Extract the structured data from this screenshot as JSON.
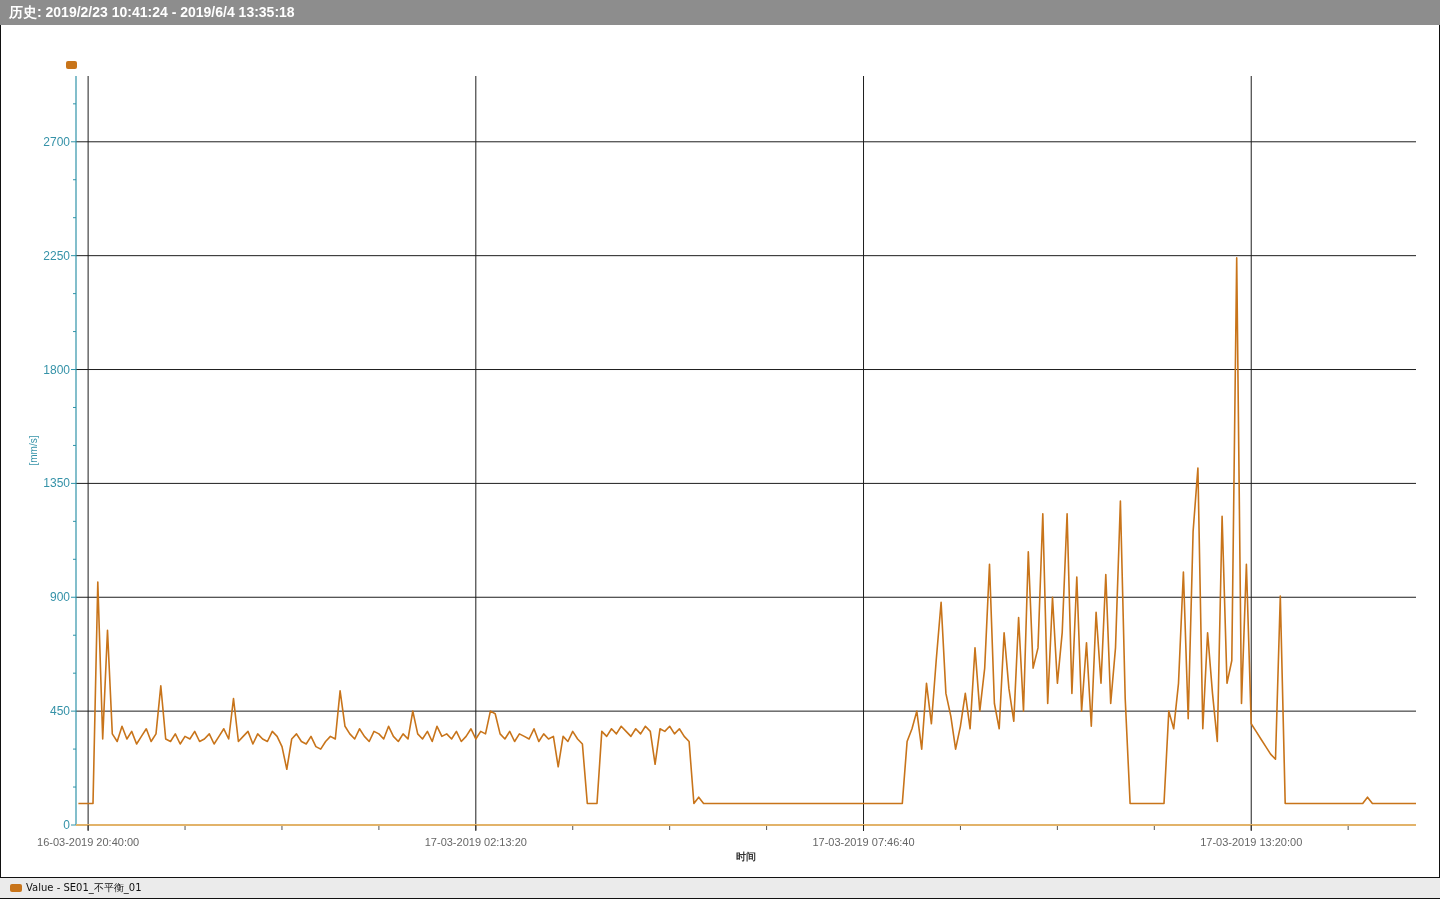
{
  "title_bar": {
    "title": "历史: 2019/2/23 10:41:24 - 2019/6/4 13:35:18"
  },
  "chart": {
    "chart_data": {
      "type": "line",
      "xlabel": "时间",
      "ylabel": "[mm/s]",
      "grid": true,
      "categories": [
        null,
        null,
        "16-03-2019 20:40:00",
        null,
        null,
        null,
        null,
        null,
        null,
        null,
        null,
        null,
        null,
        null,
        null,
        null,
        null,
        null,
        null,
        null,
        null,
        null,
        null,
        null,
        null,
        null,
        null,
        null,
        null,
        null,
        null,
        null,
        null,
        null,
        null,
        null,
        null,
        null,
        null,
        null,
        null,
        null,
        null,
        null,
        null,
        null,
        null,
        null,
        null,
        null,
        null,
        null,
        null,
        null,
        null,
        null,
        null,
        null,
        null,
        null,
        null,
        null,
        null,
        null,
        null,
        null,
        null,
        null,
        null,
        null,
        null,
        null,
        null,
        null,
        null,
        null,
        null,
        null,
        null,
        null,
        null,
        null,
        "17-03-2019 02:13:20",
        null,
        null,
        null,
        null,
        null,
        null,
        null,
        null,
        null,
        null,
        null,
        null,
        null,
        null,
        null,
        null,
        null,
        null,
        null,
        null,
        null,
        null,
        null,
        null,
        null,
        null,
        null,
        null,
        null,
        null,
        null,
        null,
        null,
        null,
        null,
        null,
        null,
        null,
        null,
        null,
        null,
        null,
        null,
        null,
        null,
        null,
        null,
        null,
        null,
        null,
        null,
        null,
        null,
        null,
        null,
        null,
        null,
        null,
        null,
        null,
        null,
        null,
        null,
        null,
        null,
        null,
        null,
        null,
        null,
        null,
        null,
        null,
        null,
        null,
        null,
        null,
        null,
        null,
        null,
        "17-03-2019 07:46:40",
        null,
        null,
        null,
        null,
        null,
        null,
        null,
        null,
        null,
        null,
        null,
        null,
        null,
        null,
        null,
        null,
        null,
        null,
        null,
        null,
        null,
        null,
        null,
        null,
        null,
        null,
        null,
        null,
        null,
        null,
        null,
        null,
        null,
        null,
        null,
        null,
        null,
        null,
        null,
        null,
        null,
        null,
        null,
        null,
        null,
        null,
        null,
        null,
        null,
        null,
        null,
        null,
        null,
        null,
        null,
        null,
        null,
        null,
        null,
        null,
        null,
        null,
        null,
        null,
        null,
        null,
        null,
        null,
        null,
        null,
        null,
        null,
        null,
        null,
        null,
        null,
        null,
        null,
        null,
        "17-03-2019 13:20:00",
        null,
        null,
        null,
        null,
        null,
        null,
        null,
        null,
        null,
        null,
        null,
        null,
        null,
        null,
        null,
        null,
        null,
        null,
        null,
        null,
        null,
        null,
        null,
        null,
        null,
        null,
        null,
        null,
        null,
        null,
        null,
        null,
        null,
        null
      ],
      "series": [
        {
          "name": "Value - SE01_不平衡_01",
          "color": "#c8741a",
          "values": [
            85,
            85,
            85,
            85,
            960,
            340,
            770,
            360,
            330,
            390,
            340,
            370,
            320,
            350,
            380,
            330,
            360,
            550,
            340,
            330,
            360,
            320,
            350,
            340,
            370,
            330,
            340,
            360,
            320,
            350,
            380,
            340,
            500,
            330,
            350,
            370,
            320,
            360,
            340,
            330,
            370,
            350,
            310,
            220,
            340,
            360,
            330,
            320,
            350,
            310,
            300,
            330,
            350,
            340,
            530,
            390,
            360,
            340,
            380,
            350,
            330,
            370,
            360,
            340,
            390,
            350,
            330,
            360,
            340,
            450,
            360,
            340,
            370,
            330,
            390,
            350,
            360,
            340,
            370,
            330,
            350,
            380,
            340,
            370,
            360,
            450,
            440,
            360,
            340,
            370,
            330,
            360,
            350,
            340,
            380,
            330,
            360,
            340,
            350,
            230,
            350,
            330,
            370,
            340,
            320,
            85,
            85,
            85,
            370,
            350,
            380,
            360,
            390,
            370,
            350,
            380,
            360,
            390,
            370,
            240,
            380,
            370,
            390,
            360,
            380,
            350,
            330,
            85,
            110,
            85,
            85,
            85,
            85,
            85,
            85,
            85,
            85,
            85,
            85,
            85,
            85,
            85,
            85,
            85,
            85,
            85,
            85,
            85,
            85,
            85,
            85,
            85,
            85,
            85,
            85,
            85,
            85,
            85,
            85,
            85,
            85,
            85,
            85,
            85,
            85,
            85,
            85,
            85,
            85,
            85,
            85,
            330,
            380,
            450,
            300,
            560,
            400,
            650,
            880,
            520,
            430,
            300,
            390,
            520,
            380,
            700,
            450,
            620,
            1030,
            480,
            380,
            760,
            540,
            410,
            820,
            450,
            1080,
            620,
            700,
            1230,
            480,
            900,
            560,
            760,
            1230,
            520,
            980,
            450,
            720,
            390,
            840,
            560,
            990,
            480,
            700,
            1280,
            500,
            85,
            85,
            85,
            85,
            85,
            85,
            85,
            85,
            450,
            380,
            560,
            1000,
            420,
            1160,
            1411,
            380,
            760,
            520,
            330,
            1220,
            560,
            650,
            2241,
            480,
            1030,
            400,
            370,
            340,
            310,
            280,
            260,
            905,
            85,
            85,
            85,
            85,
            85,
            85,
            85,
            85,
            85,
            85,
            85,
            85,
            85,
            85,
            85,
            85,
            85,
            110,
            85,
            85,
            85,
            85,
            85,
            85,
            85,
            85,
            85,
            85
          ]
        }
      ],
      "ylim": [
        0,
        2960
      ],
      "yticks": [
        0,
        450,
        900,
        1350,
        1800,
        2250,
        2700
      ]
    }
  }
}
